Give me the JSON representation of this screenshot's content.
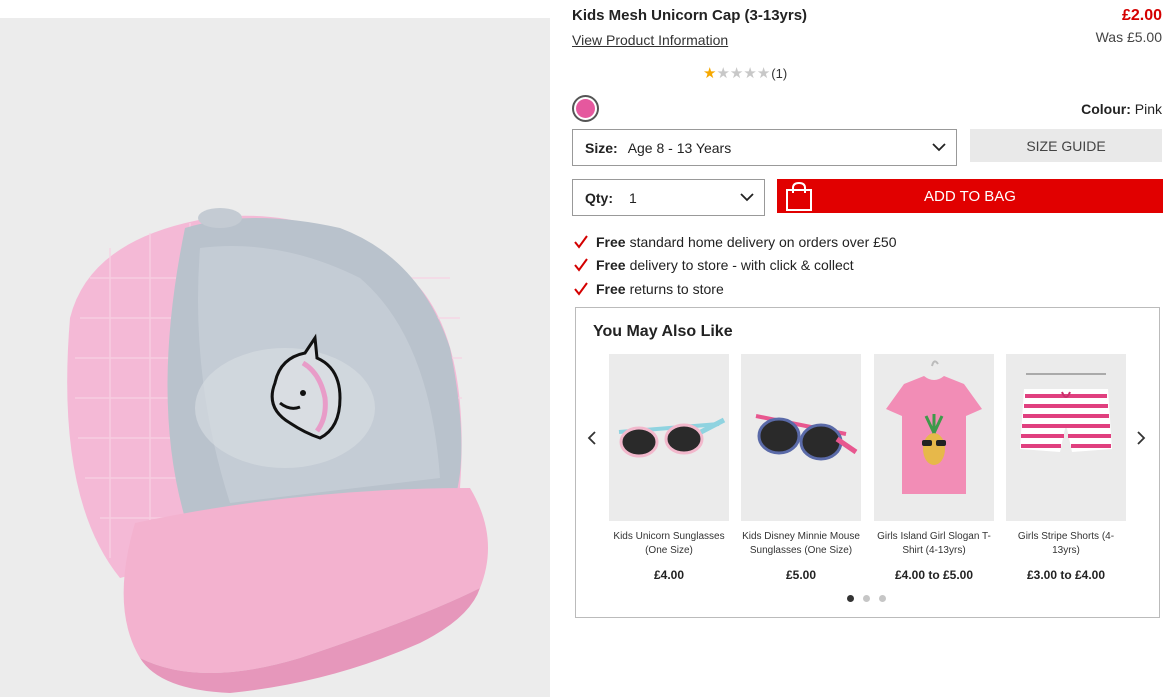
{
  "product": {
    "title": "Kids Mesh Unicorn Cap (3-13yrs)",
    "view_info_link": "View Product Information",
    "price": "£2.00",
    "was_price": "Was £5.00",
    "rating": {
      "stars_filled": 1,
      "stars_total": 5,
      "count": "(1)"
    },
    "colour": {
      "label": "Colour:",
      "value": "Pink",
      "swatch_color": "#e5589e"
    },
    "size": {
      "label": "Size:",
      "value": "Age 8 - 13 Years"
    },
    "size_guide_label": "SIZE GUIDE",
    "qty": {
      "label": "Qty:",
      "value": "1"
    },
    "add_to_bag_label": "ADD TO BAG",
    "benefits": [
      {
        "bold": "Free",
        "text": "standard home delivery on orders over £50"
      },
      {
        "bold": "Free",
        "text": "delivery to store - with click & collect"
      },
      {
        "bold": "Free",
        "text": "returns to store"
      }
    ]
  },
  "recommendations": {
    "title": "You May Also Like",
    "items": [
      {
        "name": "Kids Unicorn Sunglasses (One Size)",
        "price": "£4.00",
        "icon": "sunglasses-icon"
      },
      {
        "name": "Kids Disney Minnie Mouse Sunglasses (One Size)",
        "price": "£5.00",
        "icon": "sunglasses-icon"
      },
      {
        "name": "Girls Island Girl Slogan T-Shirt (4-13yrs)",
        "price": "£4.00 to £5.00",
        "icon": "tshirt-icon"
      },
      {
        "name": "Girls Stripe Shorts (4-13yrs)",
        "price": "£3.00 to £4.00",
        "icon": "shorts-icon"
      }
    ],
    "page_count": 3,
    "active_page": 1
  },
  "colors": {
    "accent_red": "#e10000",
    "price_red": "#d40000",
    "tick_red": "#d40000"
  }
}
